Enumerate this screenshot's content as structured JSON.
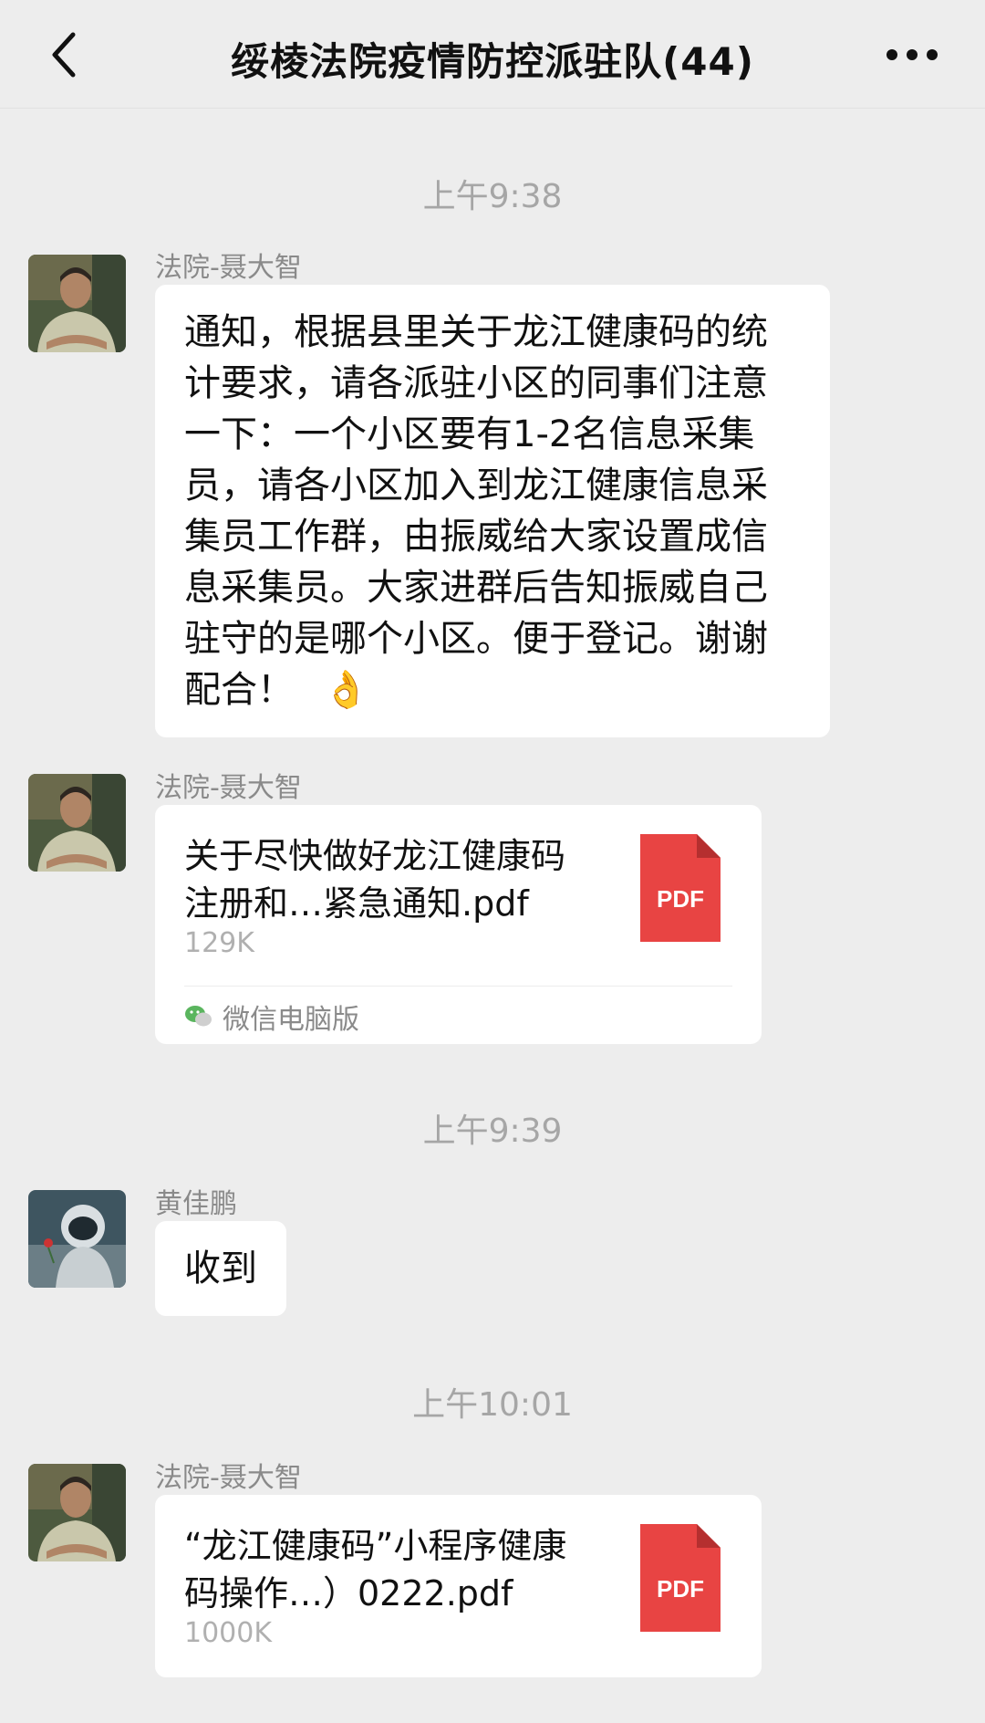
{
  "header": {
    "title": "绥棱法院疫情防控派驻队(44)",
    "back_icon": "chevron-left-icon",
    "more_icon": "more-dots-icon"
  },
  "messages": [
    {
      "time": "上午9:38",
      "sender": "法院-聂大智",
      "text": "通知，根据县里关于龙江健康码的统计要求，请各派驻小区的同事们注意一下：一个小区要有1-2名信息采集员，请各小区加入到龙江健康信息采集员工作群，由振威给大家设置成信息采集员。大家进群后告知振威自己驻守的是哪个小区。便于登记。谢谢配合！",
      "emoji": "👌"
    },
    {
      "sender": "法院-聂大智",
      "file_name": "关于尽快做好龙江健康码注册和…紧急通知.pdf",
      "file_size": "129K",
      "file_type": "PDF",
      "source": "微信电脑版"
    },
    {
      "time": "上午9:39",
      "sender": "黄佳鹏",
      "text": "收到"
    },
    {
      "time": "上午10:01",
      "sender": "法院-聂大智",
      "file_name": "“龙江健康码”小程序健康码操作…）0222.pdf",
      "file_size": "1000K",
      "file_type": "PDF"
    }
  ],
  "colors": {
    "background": "#ededed",
    "bubble": "#ffffff",
    "pdf_red": "#e84443",
    "time_gray": "#a6a6a6"
  }
}
